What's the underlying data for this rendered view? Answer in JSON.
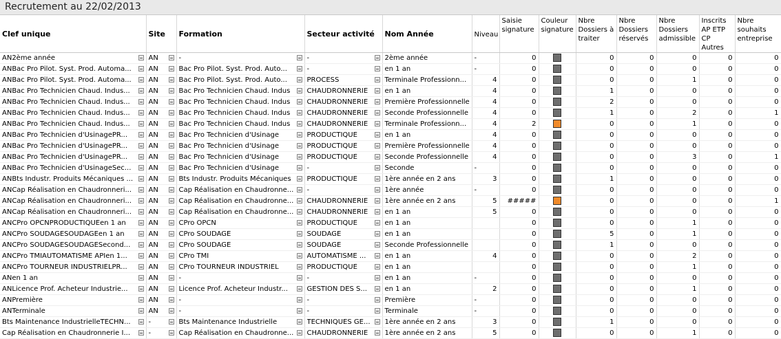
{
  "window": {
    "title": "Recrutement au 22/02/2013"
  },
  "colors": {
    "grey": "#6e6e6e",
    "orange": "#f08a2a"
  },
  "columns": [
    "Clef unique",
    "Site",
    "Formation",
    "Secteur activité",
    "Nom Année",
    "Niveau",
    "Saisie signature",
    "Couleur signature",
    "Nbre Dossiers à traiter",
    "Nbre Dossiers réservés",
    "Nbre Dossiers admissible",
    "Inscrits AP ETP CP Autres",
    "Nbre souhaits entreprise"
  ],
  "rows": [
    {
      "clef": "AN2ème année",
      "site": "AN",
      "formation": "-",
      "secteur": "-",
      "annee": "2ème année",
      "niveau": "-",
      "saisie": "0",
      "couleur": "grey",
      "a": "0",
      "b": "0",
      "c": "0",
      "d": "0",
      "e": "0"
    },
    {
      "clef": "ANBac Pro Pilot. Syst. Prod. Automa...",
      "site": "AN",
      "formation": "Bac Pro Pilot. Syst. Prod. Auto...",
      "secteur": "-",
      "annee": "en 1 an",
      "niveau": "-",
      "saisie": "0",
      "couleur": "grey",
      "a": "0",
      "b": "0",
      "c": "0",
      "d": "0",
      "e": "0"
    },
    {
      "clef": "ANBac Pro Pilot. Syst. Prod. Automa...",
      "site": "AN",
      "formation": "Bac Pro Pilot. Syst. Prod. Auto...",
      "secteur": "PROCESS",
      "annee": "Terminale Professionn...",
      "niveau": "4",
      "saisie": "0",
      "couleur": "grey",
      "a": "0",
      "b": "0",
      "c": "1",
      "d": "0",
      "e": "0"
    },
    {
      "clef": "ANBac Pro Technicien Chaud. Indus...",
      "site": "AN",
      "formation": "Bac Pro Technicien Chaud. Indus",
      "secteur": "CHAUDRONNERIE",
      "annee": "en 1 an",
      "niveau": "4",
      "saisie": "0",
      "couleur": "grey",
      "a": "1",
      "b": "0",
      "c": "0",
      "d": "0",
      "e": "0"
    },
    {
      "clef": "ANBac Pro Technicien Chaud. Indus...",
      "site": "AN",
      "formation": "Bac Pro Technicien Chaud. Indus",
      "secteur": "CHAUDRONNERIE",
      "annee": "Première Professionnelle",
      "niveau": "4",
      "saisie": "0",
      "couleur": "grey",
      "a": "2",
      "b": "0",
      "c": "0",
      "d": "0",
      "e": "0"
    },
    {
      "clef": "ANBac Pro Technicien Chaud. Indus...",
      "site": "AN",
      "formation": "Bac Pro Technicien Chaud. Indus",
      "secteur": "CHAUDRONNERIE",
      "annee": "Seconde Professionnelle",
      "niveau": "4",
      "saisie": "0",
      "couleur": "grey",
      "a": "1",
      "b": "0",
      "c": "2",
      "d": "0",
      "e": "1"
    },
    {
      "clef": "ANBac Pro Technicien Chaud. Indus...",
      "site": "AN",
      "formation": "Bac Pro Technicien Chaud. Indus",
      "secteur": "CHAUDRONNERIE",
      "annee": "Terminale Professionn...",
      "niveau": "4",
      "saisie": "2",
      "couleur": "orange",
      "a": "0",
      "b": "0",
      "c": "1",
      "d": "0",
      "e": "0"
    },
    {
      "clef": "ANBac Pro Technicien d'UsinagePR...",
      "site": "AN",
      "formation": "Bac Pro Technicien d'Usinage",
      "secteur": "PRODUCTIQUE",
      "annee": "en 1 an",
      "niveau": "4",
      "saisie": "0",
      "couleur": "grey",
      "a": "0",
      "b": "0",
      "c": "0",
      "d": "0",
      "e": "0"
    },
    {
      "clef": "ANBac Pro Technicien d'UsinagePR...",
      "site": "AN",
      "formation": "Bac Pro Technicien d'Usinage",
      "secteur": "PRODUCTIQUE",
      "annee": "Première Professionnelle",
      "niveau": "4",
      "saisie": "0",
      "couleur": "grey",
      "a": "0",
      "b": "0",
      "c": "0",
      "d": "0",
      "e": "0"
    },
    {
      "clef": "ANBac Pro Technicien d'UsinagePR...",
      "site": "AN",
      "formation": "Bac Pro Technicien d'Usinage",
      "secteur": "PRODUCTIQUE",
      "annee": "Seconde Professionnelle",
      "niveau": "4",
      "saisie": "0",
      "couleur": "grey",
      "a": "0",
      "b": "0",
      "c": "3",
      "d": "0",
      "e": "1"
    },
    {
      "clef": "ANBac Pro Technicien d'UsinageSec...",
      "site": "AN",
      "formation": "Bac Pro Technicien d'Usinage",
      "secteur": "-",
      "annee": "Seconde",
      "niveau": "-",
      "saisie": "0",
      "couleur": "grey",
      "a": "0",
      "b": "0",
      "c": "0",
      "d": "0",
      "e": "0"
    },
    {
      "clef": "ANBts Industr. Produits Mécaniques ...",
      "site": "AN",
      "formation": "Bts Industr. Produits Mécaniques",
      "secteur": "PRODUCTIQUE",
      "annee": "1ère année en 2 ans",
      "niveau": "3",
      "saisie": "0",
      "couleur": "grey",
      "a": "1",
      "b": "0",
      "c": "0",
      "d": "0",
      "e": "0"
    },
    {
      "clef": "ANCap Réalisation en Chaudronneri...",
      "site": "AN",
      "formation": "Cap Réalisation en Chaudronne...",
      "secteur": "-",
      "annee": "1ère année",
      "niveau": "-",
      "saisie": "0",
      "couleur": "grey",
      "a": "0",
      "b": "0",
      "c": "0",
      "d": "0",
      "e": "0"
    },
    {
      "clef": "ANCap Réalisation en Chaudronneri...",
      "site": "AN",
      "formation": "Cap Réalisation en Chaudronne...",
      "secteur": "CHAUDRONNERIE",
      "annee": "1ère année en 2 ans",
      "niveau": "5",
      "saisie": "#####",
      "couleur": "orange",
      "a": "0",
      "b": "0",
      "c": "0",
      "d": "0",
      "e": "1"
    },
    {
      "clef": "ANCap Réalisation en Chaudronneri...",
      "site": "AN",
      "formation": "Cap Réalisation en Chaudronne...",
      "secteur": "CHAUDRONNERIE",
      "annee": "en 1 an",
      "niveau": "5",
      "saisie": "0",
      "couleur": "grey",
      "a": "0",
      "b": "0",
      "c": "0",
      "d": "0",
      "e": "0"
    },
    {
      "clef": "ANCPro OPCNPRODUCTIQUEen 1 an",
      "site": "AN",
      "formation": "CPro OPCN",
      "secteur": "PRODUCTIQUE",
      "annee": "en 1 an",
      "niveau": "",
      "saisie": "0",
      "couleur": "grey",
      "a": "0",
      "b": "0",
      "c": "1",
      "d": "0",
      "e": "0"
    },
    {
      "clef": "ANCPro SOUDAGESOUDAGEen 1 an",
      "site": "AN",
      "formation": "CPro SOUDAGE",
      "secteur": "SOUDAGE",
      "annee": "en 1 an",
      "niveau": "",
      "saisie": "0",
      "couleur": "grey",
      "a": "5",
      "b": "0",
      "c": "1",
      "d": "0",
      "e": "0"
    },
    {
      "clef": "ANCPro SOUDAGESOUDAGESecond...",
      "site": "AN",
      "formation": "CPro SOUDAGE",
      "secteur": "SOUDAGE",
      "annee": "Seconde Professionnelle",
      "niveau": "",
      "saisie": "0",
      "couleur": "grey",
      "a": "1",
      "b": "0",
      "c": "0",
      "d": "0",
      "e": "0"
    },
    {
      "clef": "ANCPro TMIAUTOMATISME APIen 1...",
      "site": "AN",
      "formation": "CPro TMI",
      "secteur": "AUTOMATISME ...",
      "annee": "en 1 an",
      "niveau": "4",
      "saisie": "0",
      "couleur": "grey",
      "a": "0",
      "b": "0",
      "c": "2",
      "d": "0",
      "e": "0"
    },
    {
      "clef": "ANCPro TOURNEUR INDUSTRIELPR...",
      "site": "AN",
      "formation": "CPro TOURNEUR INDUSTRIEL",
      "secteur": "PRODUCTIQUE",
      "annee": "en 1 an",
      "niveau": "",
      "saisie": "0",
      "couleur": "grey",
      "a": "0",
      "b": "0",
      "c": "1",
      "d": "0",
      "e": "0"
    },
    {
      "clef": "ANen 1 an",
      "site": "AN",
      "formation": "-",
      "secteur": "-",
      "annee": "en 1 an",
      "niveau": "-",
      "saisie": "0",
      "couleur": "grey",
      "a": "0",
      "b": "0",
      "c": "0",
      "d": "0",
      "e": "0"
    },
    {
      "clef": "ANLicence Prof. Acheteur Industrie...",
      "site": "AN",
      "formation": "Licence Prof. Acheteur Industr...",
      "secteur": "GESTION DES S...",
      "annee": "en 1 an",
      "niveau": "2",
      "saisie": "0",
      "couleur": "grey",
      "a": "0",
      "b": "0",
      "c": "1",
      "d": "0",
      "e": "0"
    },
    {
      "clef": "ANPremière",
      "site": "AN",
      "formation": "-",
      "secteur": "-",
      "annee": "Première",
      "niveau": "-",
      "saisie": "0",
      "couleur": "grey",
      "a": "0",
      "b": "0",
      "c": "0",
      "d": "0",
      "e": "0"
    },
    {
      "clef": "ANTerminale",
      "site": "AN",
      "formation": "-",
      "secteur": "-",
      "annee": "Terminale",
      "niveau": "-",
      "saisie": "0",
      "couleur": "grey",
      "a": "0",
      "b": "0",
      "c": "0",
      "d": "0",
      "e": "0"
    },
    {
      "clef": "Bts Maintenance IndustrielleTECHN...",
      "site": "-",
      "formation": "Bts Maintenance Industrielle",
      "secteur": "TECHNIQUES GE...",
      "annee": "1ère année en 2 ans",
      "niveau": "3",
      "saisie": "0",
      "couleur": "grey",
      "a": "1",
      "b": "0",
      "c": "0",
      "d": "0",
      "e": "0"
    },
    {
      "clef": "Cap Réalisation en Chaudronnerie I...",
      "site": "-",
      "formation": "Cap Réalisation en Chaudronne...",
      "secteur": "CHAUDRONNERIE",
      "annee": "1ère année en 2 ans",
      "niveau": "5",
      "saisie": "0",
      "couleur": "grey",
      "a": "0",
      "b": "0",
      "c": "1",
      "d": "0",
      "e": "0"
    }
  ]
}
